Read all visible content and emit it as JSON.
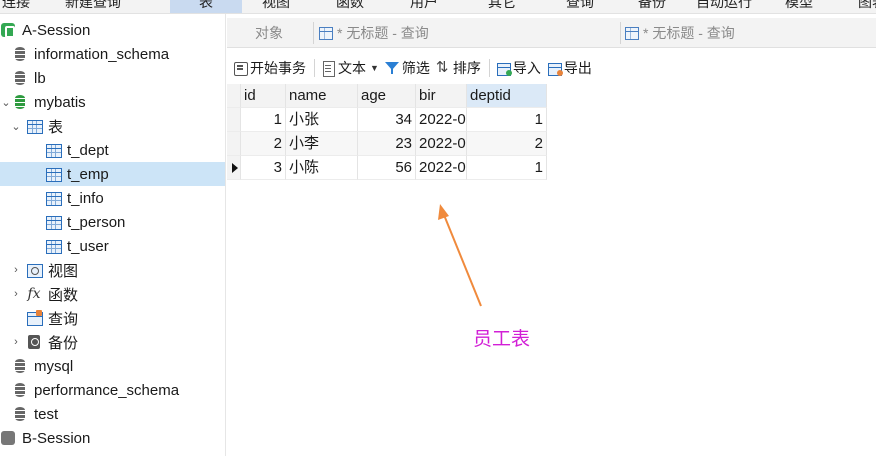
{
  "top_toolbar": [
    "连接",
    "新建查询",
    "表",
    "视图",
    "函数",
    "用户",
    "其它",
    "查询",
    "备份",
    "自动运行",
    "模型",
    "图表"
  ],
  "tree": [
    {
      "label": "A-Session",
      "icon": "session-icon",
      "level": 0
    },
    {
      "label": "information_schema",
      "icon": "database-icon",
      "level": 1
    },
    {
      "label": "lb",
      "icon": "database-icon",
      "level": 1
    },
    {
      "label": "mybatis",
      "icon": "database-open-icon",
      "level": 1,
      "expanded": true
    },
    {
      "label": "表",
      "icon": "table-folder-icon",
      "level": 2,
      "expanded": true
    },
    {
      "label": "t_dept",
      "icon": "table-icon",
      "level": 3
    },
    {
      "label": "t_emp",
      "icon": "table-icon",
      "level": 3,
      "selected": true
    },
    {
      "label": "t_info",
      "icon": "table-icon",
      "level": 3
    },
    {
      "label": "t_person",
      "icon": "table-icon",
      "level": 3
    },
    {
      "label": "t_user",
      "icon": "table-icon",
      "level": 3
    },
    {
      "label": "视图",
      "icon": "view-icon",
      "level": 2
    },
    {
      "label": "函数",
      "icon": "function-icon",
      "level": 2
    },
    {
      "label": "查询",
      "icon": "query-icon",
      "level": 2
    },
    {
      "label": "备份",
      "icon": "backup-icon",
      "level": 2
    },
    {
      "label": "mysql",
      "icon": "database-icon",
      "level": 1
    },
    {
      "label": "performance_schema",
      "icon": "database-icon",
      "level": 1
    },
    {
      "label": "test",
      "icon": "database-icon",
      "level": 1
    },
    {
      "label": "B-Session",
      "icon": "session-icon",
      "level": 0
    }
  ],
  "tabs": {
    "objects": "对象",
    "query1": "* 无标题 - 查询",
    "query2": "* 无标题 - 查询"
  },
  "toolbar": {
    "begin_tx": "开始事务",
    "text": "文本",
    "filter": "筛选",
    "sort": "排序",
    "import": "导入",
    "export": "导出"
  },
  "grid": {
    "columns": [
      "id",
      "name",
      "age",
      "bir",
      "deptid"
    ],
    "rows": [
      [
        "1",
        "小张",
        "34",
        "2022-0",
        "1"
      ],
      [
        "2",
        "小李",
        "23",
        "2022-0",
        "2"
      ],
      [
        "3",
        "小陈",
        "56",
        "2022-0",
        "1"
      ]
    ]
  },
  "annotation": {
    "text": "员工表",
    "color": "#d21fd6",
    "arrow_color": "#f08a3c"
  }
}
